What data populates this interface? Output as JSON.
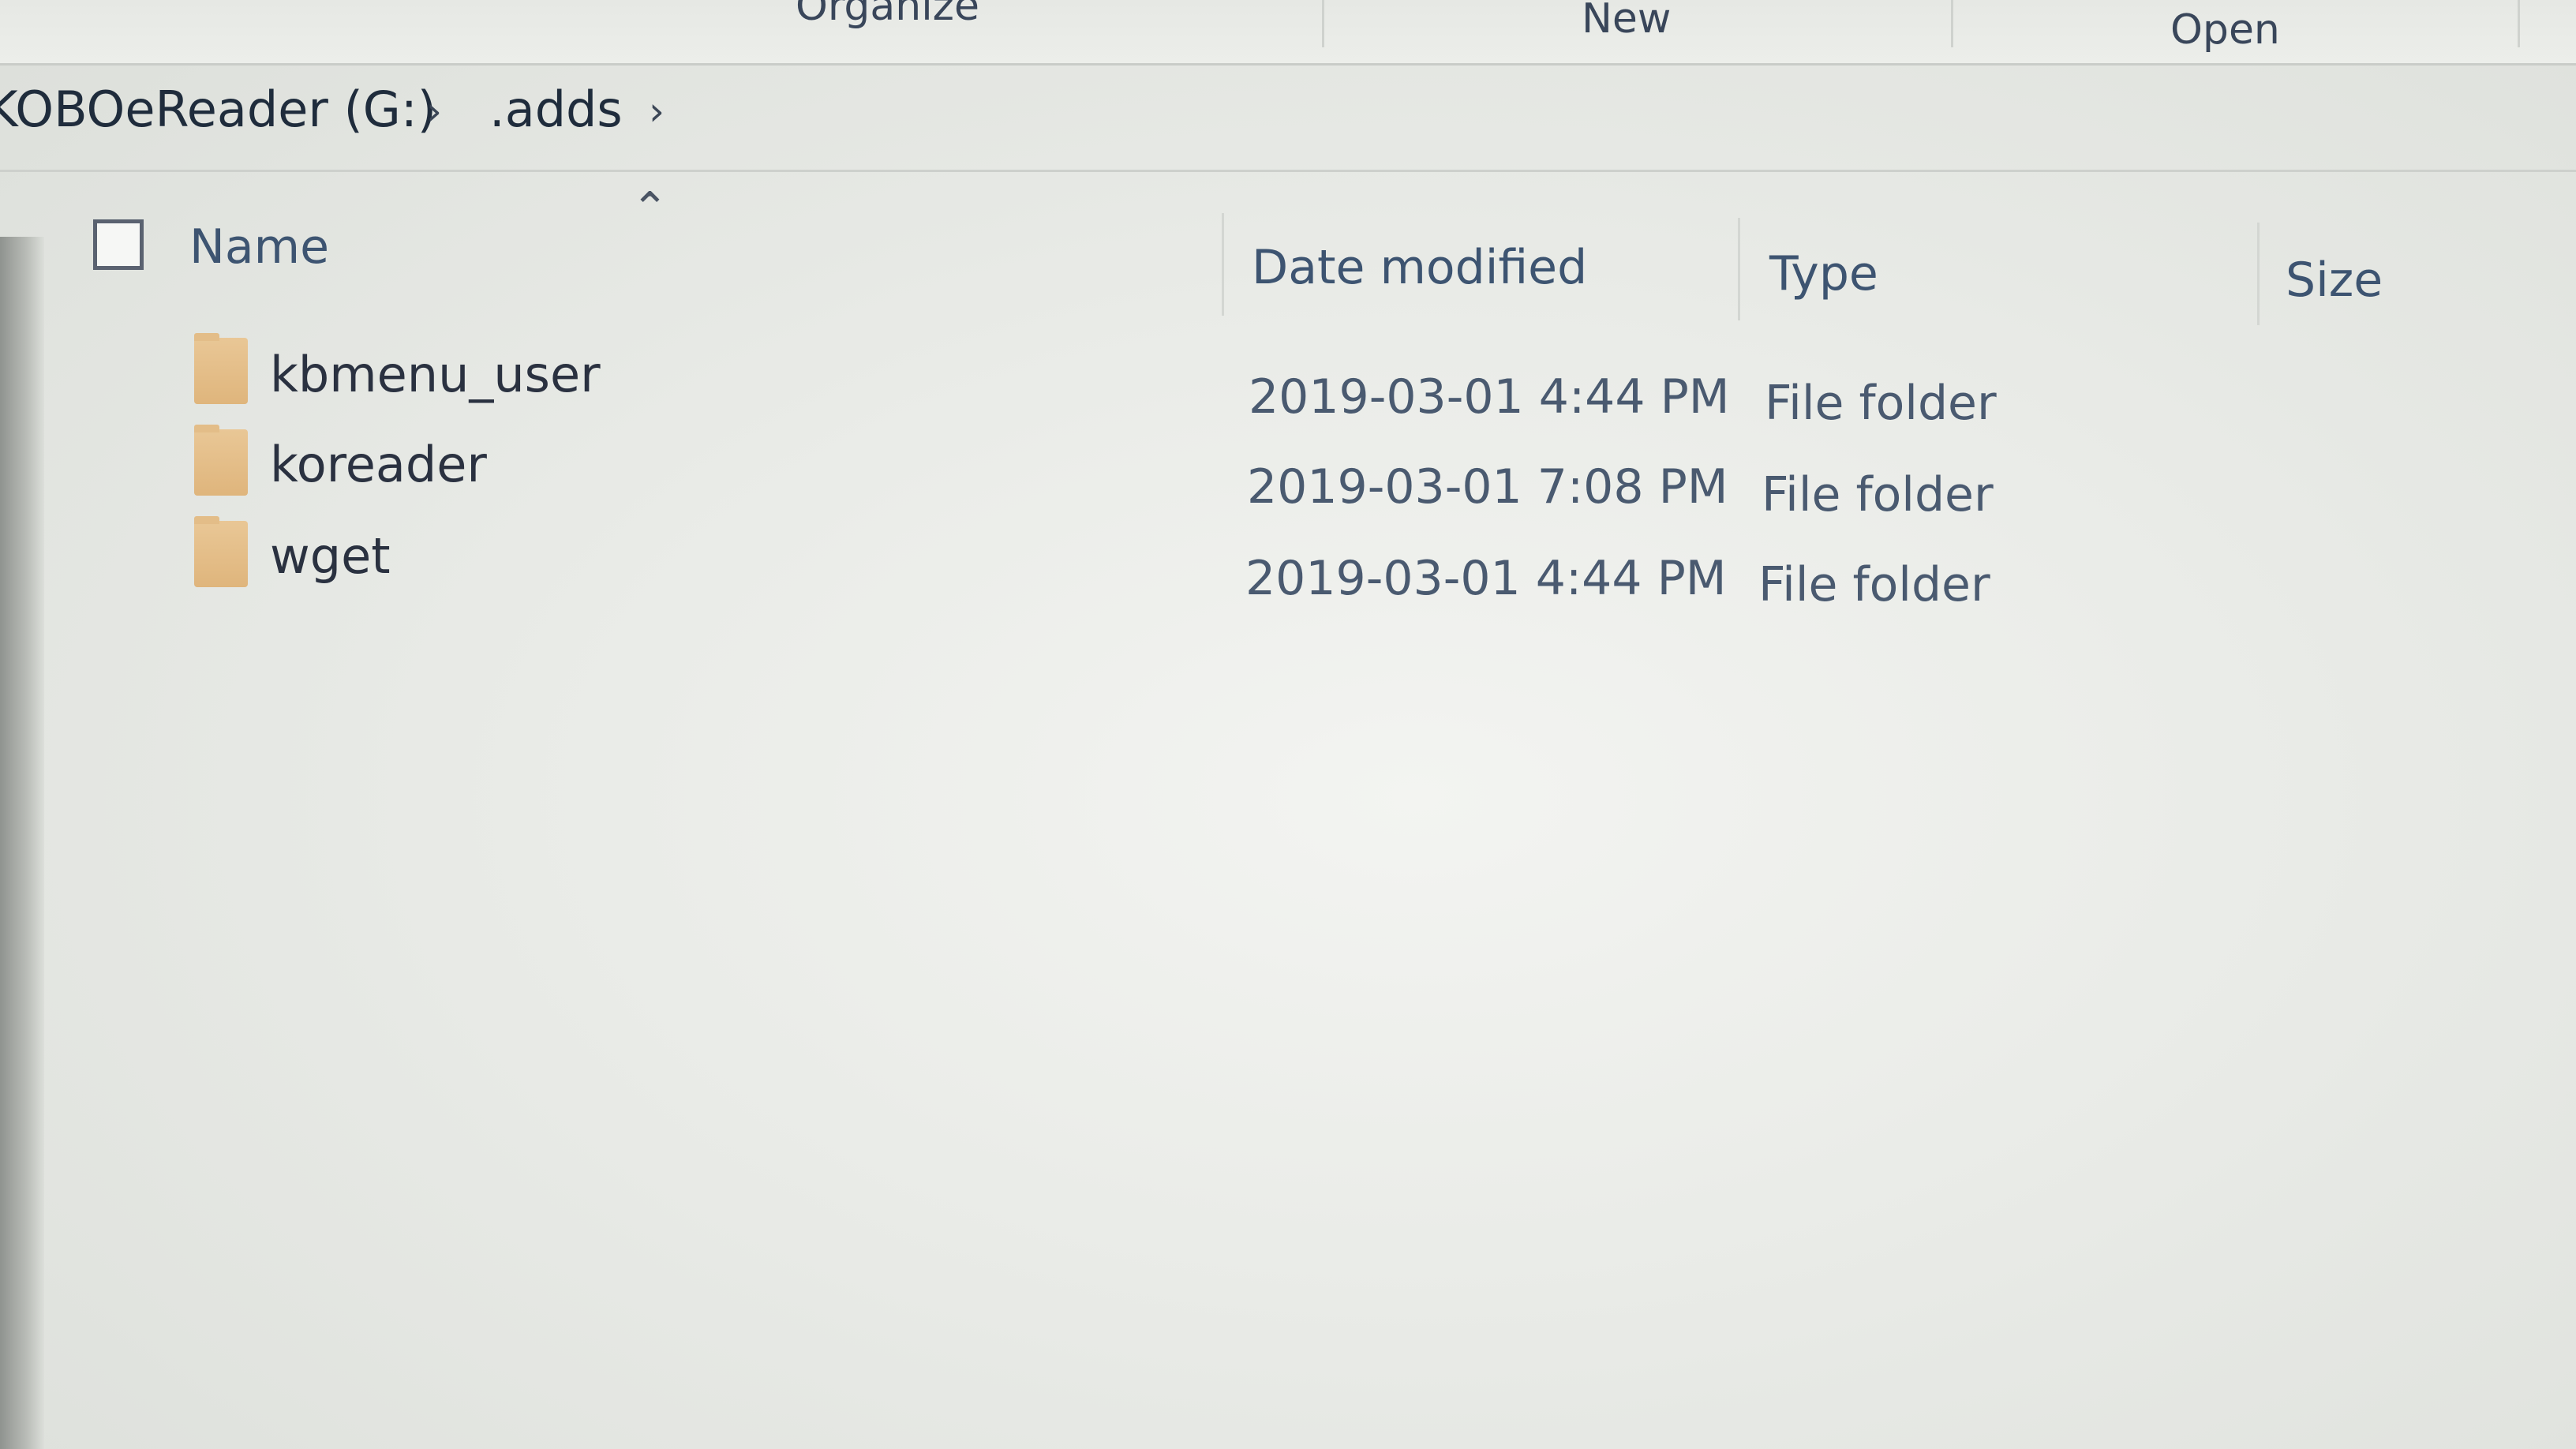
{
  "ribbon": {
    "organize": "Organize",
    "new": "New",
    "open": "Open"
  },
  "breadcrumb": {
    "drive": "KOBOeReader (G:)",
    "folder": ".adds"
  },
  "columns": {
    "name": "Name",
    "date_modified": "Date modified",
    "type": "Type",
    "size": "Size"
  },
  "files": [
    {
      "name": "kbmenu_user",
      "date_modified": "2019-03-01 4:44 PM",
      "type": "File folder"
    },
    {
      "name": "koreader",
      "date_modified": "2019-03-01 7:08 PM",
      "type": "File folder"
    },
    {
      "name": "wget",
      "date_modified": "2019-03-01 4:44 PM",
      "type": "File folder"
    }
  ],
  "icons": {
    "folder": "folder-icon",
    "chevron": "chevron-right-icon",
    "sort": "sort-ascending-icon"
  },
  "colors": {
    "folder": "#e3bd88",
    "text": "#2a3140",
    "header_text": "#3d5471"
  }
}
